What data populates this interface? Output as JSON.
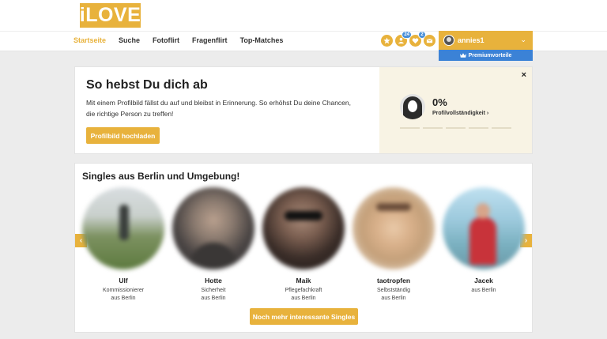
{
  "brand": {
    "logo": "iLOVE",
    "accent": "#e8b23c",
    "premium_color": "#3b82d6"
  },
  "nav": {
    "items": [
      "Startseite",
      "Suche",
      "Fotoflirt",
      "Fragenflirt",
      "Top-Matches"
    ],
    "active": "Startseite"
  },
  "header_icons": [
    {
      "icon": "star-icon",
      "badge": ""
    },
    {
      "icon": "visitors-icon",
      "badge": "24"
    },
    {
      "icon": "likes-icon",
      "badge": "2"
    },
    {
      "icon": "mail-icon",
      "badge": ""
    }
  ],
  "user": {
    "name": "annies1",
    "premium_label": "Premiumvorteile"
  },
  "profile_card": {
    "title": "So hebst Du dich ab",
    "text": "Mit einem Profilbild fällst du auf und bleibst in Erinnerung. So erhöhst Du deine Chancen, die richtige Person zu treffen!",
    "button": "Profilbild hochladen",
    "completeness_value": "0%",
    "completeness_label": "Profilvollständigkeit",
    "completeness_fraction": 0,
    "close_symbol": "×"
  },
  "singles": {
    "title": "Singles aus Berlin und Umgebung!",
    "people": [
      {
        "name": "Ulf",
        "job": "Kommissionierer",
        "location": "aus Berlin"
      },
      {
        "name": "Hotte",
        "job": "Sicherheit",
        "location": "aus Berlin"
      },
      {
        "name": "Maik",
        "job": "Pflegefachkraft",
        "location": "aus Berlin"
      },
      {
        "name": "taotropfen",
        "job": "Selbstständig",
        "location": "aus Berlin"
      },
      {
        "name": "Jacek",
        "job": "",
        "location": "aus Berlin"
      }
    ],
    "more_button": "Noch mehr interessante Singles",
    "prev_arrow": "‹",
    "next_arrow": "›"
  }
}
